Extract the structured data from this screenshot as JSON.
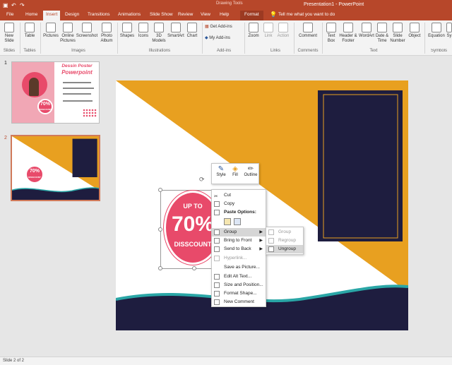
{
  "app": {
    "title": "Presentation1 - PowerPoint",
    "context": "Drawing Tools"
  },
  "tabs": [
    "File",
    "Home",
    "Insert",
    "Design",
    "Transitions",
    "Animations",
    "Slide Show",
    "Review",
    "View",
    "Help",
    "Format"
  ],
  "tell_me": "Tell me what you want to do",
  "ribbon": {
    "new_slide": "New Slide",
    "table": "Table",
    "pictures": "Pictures",
    "online_pictures": "Online Pictures",
    "screenshot": "Screenshot",
    "photo_album": "Photo Album",
    "shapes": "Shapes",
    "icons": "Icons",
    "models_3d": "3D Models",
    "smartart": "SmartArt",
    "chart": "Chart",
    "get_addins": "Get Add-ins",
    "my_addins": "My Add-ins",
    "zoom": "Zoom",
    "link": "Link",
    "action": "Action",
    "comment": "Comment",
    "text_box": "Text Box",
    "header_footer": "Header & Footer",
    "wordart": "WordArt",
    "date_time": "Date & Time",
    "slide_number": "Slide Number",
    "object": "Object",
    "equation": "Equation",
    "symbol": "Sy",
    "groups": {
      "slides": "Slides",
      "tables": "Tables",
      "images": "Images",
      "illustrations": "Illustrations",
      "addins": "Add-ins",
      "links": "Links",
      "comments": "Comments",
      "text": "Text",
      "symbols": "Symbols"
    }
  },
  "thumbnails": {
    "slide1": {
      "num": "1",
      "title1": "Dessin Poster",
      "title2": "Powerpoint",
      "badge": "70%",
      "badge_sub": "DISSCOUNT"
    },
    "slide2": {
      "num": "2",
      "badge": "70%",
      "badge_sub": "DISSCOUNT"
    }
  },
  "slide": {
    "badge_top": "UP TO",
    "badge_big": "70%",
    "badge_bottom": "DISSCOUNT"
  },
  "mini_toolbar": {
    "style": "Style",
    "fill": "Fill",
    "outline": "Outline"
  },
  "context_menu": {
    "cut": "Cut",
    "copy": "Copy",
    "paste_options": "Paste Options:",
    "group": "Group",
    "bring_to_front": "Bring to Front",
    "send_to_back": "Send to Back",
    "hyperlink": "Hyperlink...",
    "save_as_picture": "Save as Picture...",
    "edit_alt_text": "Edit Alt Text...",
    "size_position": "Size and Position...",
    "format_shape": "Format Shape...",
    "new_comment": "New Comment"
  },
  "submenu": {
    "group": "Group",
    "regroup": "Regroup",
    "ungroup": "Ungroup"
  },
  "status": {
    "slide_info": "Slide 2 of 2"
  },
  "colors": {
    "brand": "#b7472a",
    "orange": "#e8a020",
    "navy": "#1e1d3f",
    "pink": "#e84a6a",
    "teal": "#2aa6a6"
  }
}
